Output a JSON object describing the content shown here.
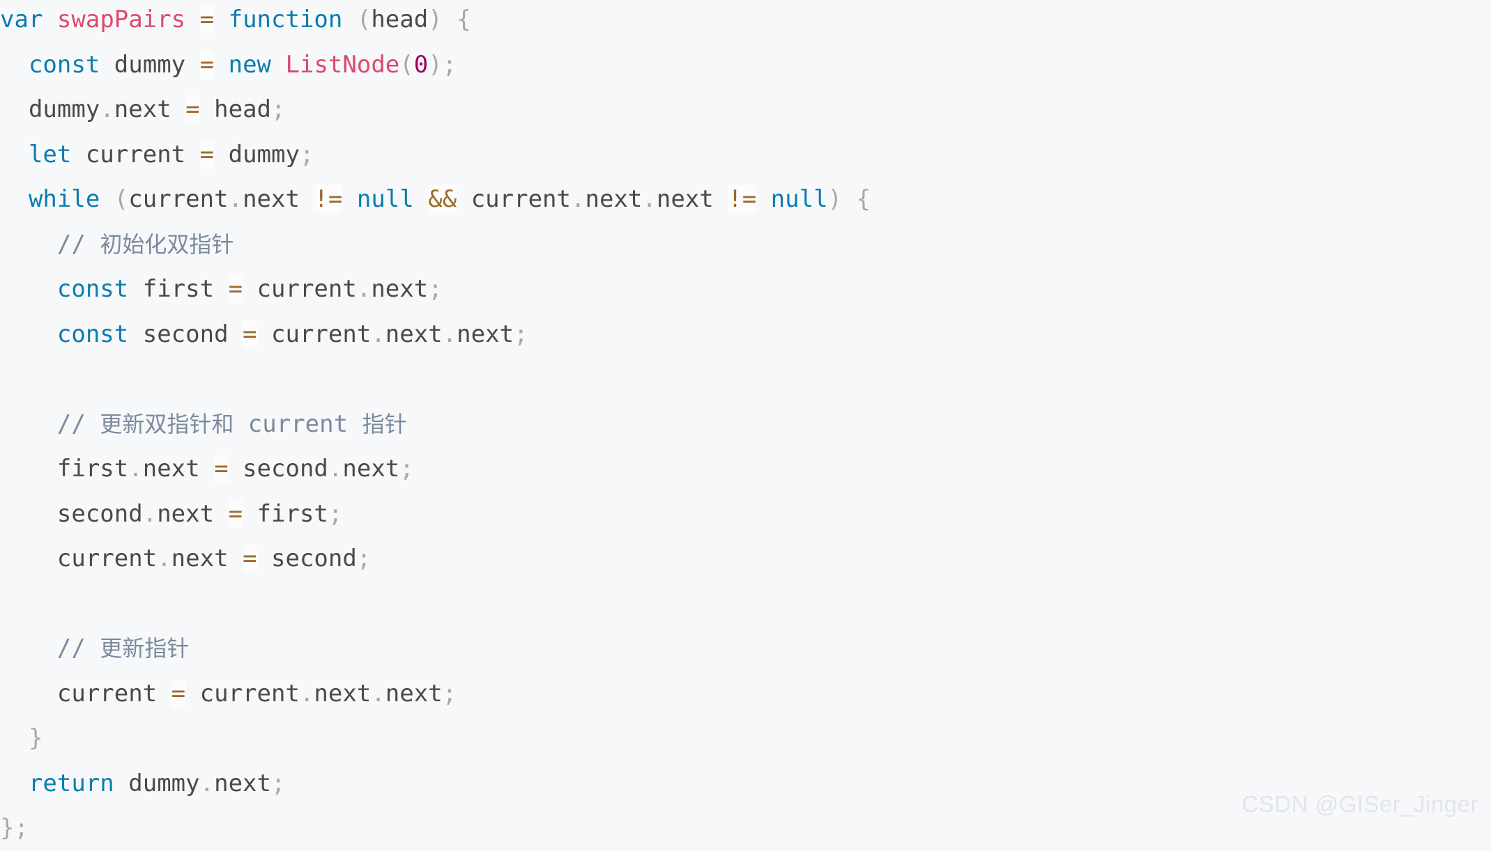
{
  "editor": {
    "language": "javascript",
    "background_color": "#f7f8fa",
    "theme_colors": {
      "keyword": "#0c7cb0",
      "function_name": "#dc4a6c",
      "number": "#9e0060",
      "plain_text": "#4a4a4a",
      "punctuation": "#a8a8a8",
      "comment": "#7b8a9e",
      "operator": "#9d6b2a",
      "operator_highlight": "#fcfcfd"
    },
    "lines": [
      {
        "n": 1,
        "text": "var swapPairs = function (head) {",
        "tokens": [
          {
            "t": "var",
            "c": "kw"
          },
          {
            "t": " ",
            "c": "txt"
          },
          {
            "t": "swapPairs",
            "c": "fn"
          },
          {
            "t": " ",
            "c": "txt"
          },
          {
            "t": "=",
            "c": "op"
          },
          {
            "t": " ",
            "c": "txt"
          },
          {
            "t": "function",
            "c": "kw"
          },
          {
            "t": " ",
            "c": "txt"
          },
          {
            "t": "(",
            "c": "pun"
          },
          {
            "t": "head",
            "c": "txt"
          },
          {
            "t": ")",
            "c": "pun"
          },
          {
            "t": " ",
            "c": "txt"
          },
          {
            "t": "{",
            "c": "pun"
          }
        ]
      },
      {
        "n": 2,
        "text": "  const dummy = new ListNode(0);",
        "tokens": [
          {
            "t": "  ",
            "c": "txt"
          },
          {
            "t": "const",
            "c": "kw"
          },
          {
            "t": " ",
            "c": "txt"
          },
          {
            "t": "dummy",
            "c": "txt"
          },
          {
            "t": " ",
            "c": "txt"
          },
          {
            "t": "=",
            "c": "op"
          },
          {
            "t": " ",
            "c": "txt"
          },
          {
            "t": "new",
            "c": "kw"
          },
          {
            "t": " ",
            "c": "txt"
          },
          {
            "t": "ListNode",
            "c": "fn"
          },
          {
            "t": "(",
            "c": "pun"
          },
          {
            "t": "0",
            "c": "num"
          },
          {
            "t": ")",
            "c": "pun"
          },
          {
            "t": ";",
            "c": "pun"
          }
        ]
      },
      {
        "n": 3,
        "text": "  dummy.next = head;",
        "tokens": [
          {
            "t": "  ",
            "c": "txt"
          },
          {
            "t": "dummy",
            "c": "txt"
          },
          {
            "t": ".",
            "c": "pun"
          },
          {
            "t": "next",
            "c": "txt"
          },
          {
            "t": " ",
            "c": "txt"
          },
          {
            "t": "=",
            "c": "op"
          },
          {
            "t": " ",
            "c": "txt"
          },
          {
            "t": "head",
            "c": "txt"
          },
          {
            "t": ";",
            "c": "pun"
          }
        ]
      },
      {
        "n": 4,
        "text": "  let current = dummy;",
        "tokens": [
          {
            "t": "  ",
            "c": "txt"
          },
          {
            "t": "let",
            "c": "kw"
          },
          {
            "t": " ",
            "c": "txt"
          },
          {
            "t": "current",
            "c": "txt"
          },
          {
            "t": " ",
            "c": "txt"
          },
          {
            "t": "=",
            "c": "op"
          },
          {
            "t": " ",
            "c": "txt"
          },
          {
            "t": "dummy",
            "c": "txt"
          },
          {
            "t": ";",
            "c": "pun"
          }
        ]
      },
      {
        "n": 5,
        "text": "  while (current.next != null && current.next.next != null) {",
        "tokens": [
          {
            "t": "  ",
            "c": "txt"
          },
          {
            "t": "while",
            "c": "kw"
          },
          {
            "t": " ",
            "c": "txt"
          },
          {
            "t": "(",
            "c": "pun"
          },
          {
            "t": "current",
            "c": "txt"
          },
          {
            "t": ".",
            "c": "pun"
          },
          {
            "t": "next",
            "c": "txt"
          },
          {
            "t": " ",
            "c": "txt"
          },
          {
            "t": "!=",
            "c": "op"
          },
          {
            "t": " ",
            "c": "txt"
          },
          {
            "t": "null",
            "c": "kw"
          },
          {
            "t": " ",
            "c": "txt"
          },
          {
            "t": "&&",
            "c": "op"
          },
          {
            "t": " ",
            "c": "txt"
          },
          {
            "t": "current",
            "c": "txt"
          },
          {
            "t": ".",
            "c": "pun"
          },
          {
            "t": "next",
            "c": "txt"
          },
          {
            "t": ".",
            "c": "pun"
          },
          {
            "t": "next",
            "c": "txt"
          },
          {
            "t": " ",
            "c": "txt"
          },
          {
            "t": "!=",
            "c": "op"
          },
          {
            "t": " ",
            "c": "txt"
          },
          {
            "t": "null",
            "c": "kw"
          },
          {
            "t": ")",
            "c": "pun"
          },
          {
            "t": " ",
            "c": "txt"
          },
          {
            "t": "{",
            "c": "pun"
          }
        ]
      },
      {
        "n": 6,
        "text": "    // 初始化双指针",
        "tokens": [
          {
            "t": "    ",
            "c": "txt"
          },
          {
            "t": "// ",
            "c": "cmt"
          },
          {
            "t": "初始化双指针",
            "c": "cmt-cjk"
          }
        ]
      },
      {
        "n": 7,
        "text": "    const first = current.next;",
        "tokens": [
          {
            "t": "    ",
            "c": "txt"
          },
          {
            "t": "const",
            "c": "kw"
          },
          {
            "t": " ",
            "c": "txt"
          },
          {
            "t": "first",
            "c": "txt"
          },
          {
            "t": " ",
            "c": "txt"
          },
          {
            "t": "=",
            "c": "op"
          },
          {
            "t": " ",
            "c": "txt"
          },
          {
            "t": "current",
            "c": "txt"
          },
          {
            "t": ".",
            "c": "pun"
          },
          {
            "t": "next",
            "c": "txt"
          },
          {
            "t": ";",
            "c": "pun"
          }
        ]
      },
      {
        "n": 8,
        "text": "    const second = current.next.next;",
        "tokens": [
          {
            "t": "    ",
            "c": "txt"
          },
          {
            "t": "const",
            "c": "kw"
          },
          {
            "t": " ",
            "c": "txt"
          },
          {
            "t": "second",
            "c": "txt"
          },
          {
            "t": " ",
            "c": "txt"
          },
          {
            "t": "=",
            "c": "op"
          },
          {
            "t": " ",
            "c": "txt"
          },
          {
            "t": "current",
            "c": "txt"
          },
          {
            "t": ".",
            "c": "pun"
          },
          {
            "t": "next",
            "c": "txt"
          },
          {
            "t": ".",
            "c": "pun"
          },
          {
            "t": "next",
            "c": "txt"
          },
          {
            "t": ";",
            "c": "pun"
          }
        ]
      },
      {
        "n": 9,
        "text": "",
        "tokens": []
      },
      {
        "n": 10,
        "text": "    // 更新双指针和 current 指针",
        "tokens": [
          {
            "t": "    ",
            "c": "txt"
          },
          {
            "t": "// ",
            "c": "cmt"
          },
          {
            "t": "更新双指针和",
            "c": "cmt-cjk"
          },
          {
            "t": " current ",
            "c": "cmt"
          },
          {
            "t": "指针",
            "c": "cmt-cjk"
          }
        ]
      },
      {
        "n": 11,
        "text": "    first.next = second.next;",
        "tokens": [
          {
            "t": "    ",
            "c": "txt"
          },
          {
            "t": "first",
            "c": "txt"
          },
          {
            "t": ".",
            "c": "pun"
          },
          {
            "t": "next",
            "c": "txt"
          },
          {
            "t": " ",
            "c": "txt"
          },
          {
            "t": "=",
            "c": "op"
          },
          {
            "t": " ",
            "c": "txt"
          },
          {
            "t": "second",
            "c": "txt"
          },
          {
            "t": ".",
            "c": "pun"
          },
          {
            "t": "next",
            "c": "txt"
          },
          {
            "t": ";",
            "c": "pun"
          }
        ]
      },
      {
        "n": 12,
        "text": "    second.next = first;",
        "tokens": [
          {
            "t": "    ",
            "c": "txt"
          },
          {
            "t": "second",
            "c": "txt"
          },
          {
            "t": ".",
            "c": "pun"
          },
          {
            "t": "next",
            "c": "txt"
          },
          {
            "t": " ",
            "c": "txt"
          },
          {
            "t": "=",
            "c": "op"
          },
          {
            "t": " ",
            "c": "txt"
          },
          {
            "t": "first",
            "c": "txt"
          },
          {
            "t": ";",
            "c": "pun"
          }
        ]
      },
      {
        "n": 13,
        "text": "    current.next = second;",
        "tokens": [
          {
            "t": "    ",
            "c": "txt"
          },
          {
            "t": "current",
            "c": "txt"
          },
          {
            "t": ".",
            "c": "pun"
          },
          {
            "t": "next",
            "c": "txt"
          },
          {
            "t": " ",
            "c": "txt"
          },
          {
            "t": "=",
            "c": "op"
          },
          {
            "t": " ",
            "c": "txt"
          },
          {
            "t": "second",
            "c": "txt"
          },
          {
            "t": ";",
            "c": "pun"
          }
        ]
      },
      {
        "n": 14,
        "text": "",
        "tokens": []
      },
      {
        "n": 15,
        "text": "    // 更新指针",
        "tokens": [
          {
            "t": "    ",
            "c": "txt"
          },
          {
            "t": "// ",
            "c": "cmt"
          },
          {
            "t": "更新指针",
            "c": "cmt-cjk"
          }
        ]
      },
      {
        "n": 16,
        "text": "    current = current.next.next;",
        "tokens": [
          {
            "t": "    ",
            "c": "txt"
          },
          {
            "t": "current",
            "c": "txt"
          },
          {
            "t": " ",
            "c": "txt"
          },
          {
            "t": "=",
            "c": "op"
          },
          {
            "t": " ",
            "c": "txt"
          },
          {
            "t": "current",
            "c": "txt"
          },
          {
            "t": ".",
            "c": "pun"
          },
          {
            "t": "next",
            "c": "txt"
          },
          {
            "t": ".",
            "c": "pun"
          },
          {
            "t": "next",
            "c": "txt"
          },
          {
            "t": ";",
            "c": "pun"
          }
        ]
      },
      {
        "n": 17,
        "text": "  }",
        "tokens": [
          {
            "t": "  ",
            "c": "txt"
          },
          {
            "t": "}",
            "c": "pun"
          }
        ]
      },
      {
        "n": 18,
        "text": "  return dummy.next;",
        "tokens": [
          {
            "t": "  ",
            "c": "txt"
          },
          {
            "t": "return",
            "c": "kw"
          },
          {
            "t": " ",
            "c": "txt"
          },
          {
            "t": "dummy",
            "c": "txt"
          },
          {
            "t": ".",
            "c": "pun"
          },
          {
            "t": "next",
            "c": "txt"
          },
          {
            "t": ";",
            "c": "pun"
          }
        ]
      },
      {
        "n": 19,
        "text": "};",
        "tokens": [
          {
            "t": "}",
            "c": "pun"
          },
          {
            "t": ";",
            "c": "pun"
          }
        ]
      }
    ]
  },
  "watermark": {
    "text": "CSDN @GISer_Jinger"
  }
}
